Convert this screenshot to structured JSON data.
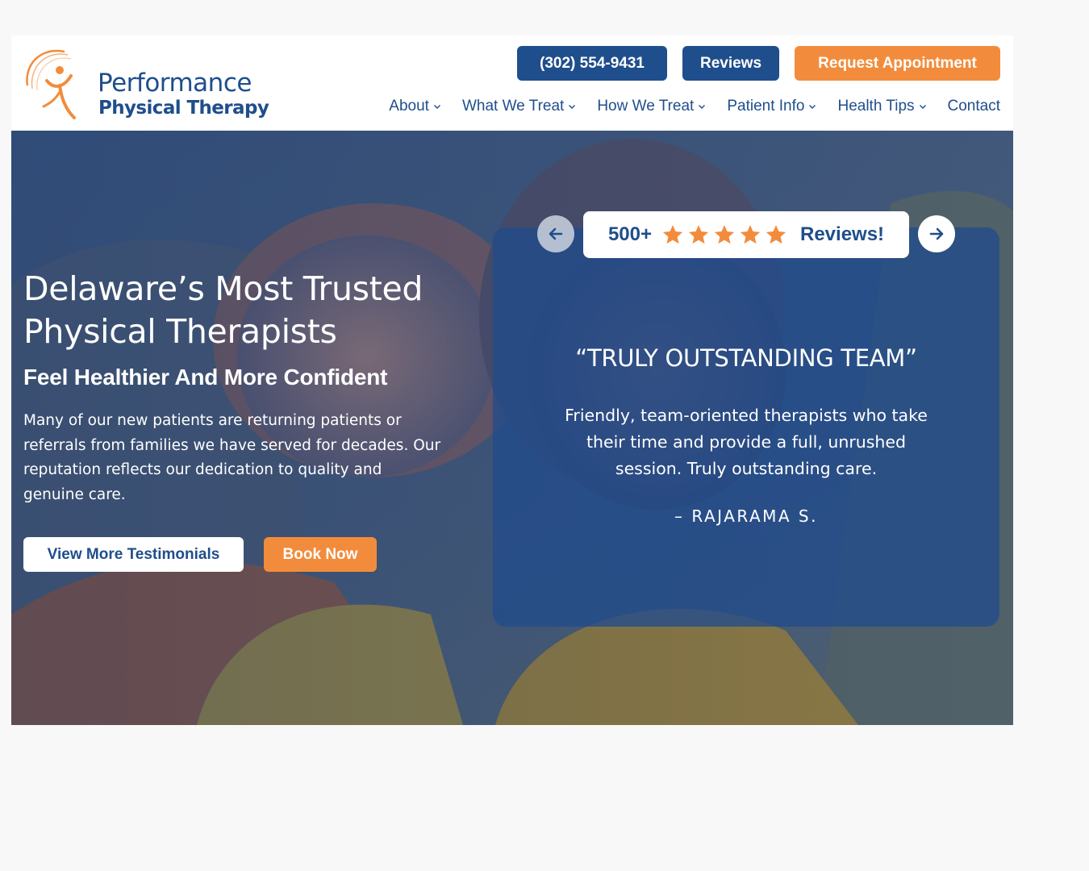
{
  "header": {
    "logo": {
      "line1": "Performance",
      "line2": "Physical Therapy"
    },
    "phone_label": "(302) 554-9431",
    "reviews_label": "Reviews",
    "request_label": "Request Appointment",
    "nav": [
      {
        "label": "About",
        "has_dropdown": true
      },
      {
        "label": "What We Treat",
        "has_dropdown": true
      },
      {
        "label": "How We Treat",
        "has_dropdown": true
      },
      {
        "label": "Patient Info",
        "has_dropdown": true
      },
      {
        "label": "Health Tips",
        "has_dropdown": true
      },
      {
        "label": "Contact",
        "has_dropdown": false
      }
    ]
  },
  "hero": {
    "title_line1": "Delaware’s Most Trusted",
    "title_line2": "Physical Therapists",
    "subtitle": "Feel Healthier And More Confident",
    "body_lines": [
      "Many of our new patients are returning patients or",
      "referrals from families we have served for decades. Our",
      "reputation reflects our dedication to quality and",
      "genuine care."
    ],
    "testimonials_button": "View More Testimonials",
    "book_button": "Book Now"
  },
  "reviews": {
    "count": "500+",
    "rating_stars": 5,
    "label": "Reviews!",
    "quote_title": "“TRULY OUTSTANDING TEAM”",
    "quote_lines": [
      "Friendly, team-oriented therapists who take",
      "their time and provide a full, unrushed",
      "session. Truly outstanding care."
    ],
    "author": "– RAJARAMA S."
  },
  "colors": {
    "brand_navy": "#1f4e8c",
    "brand_orange": "#f28c3c",
    "page_background": "#f7f8f7"
  }
}
